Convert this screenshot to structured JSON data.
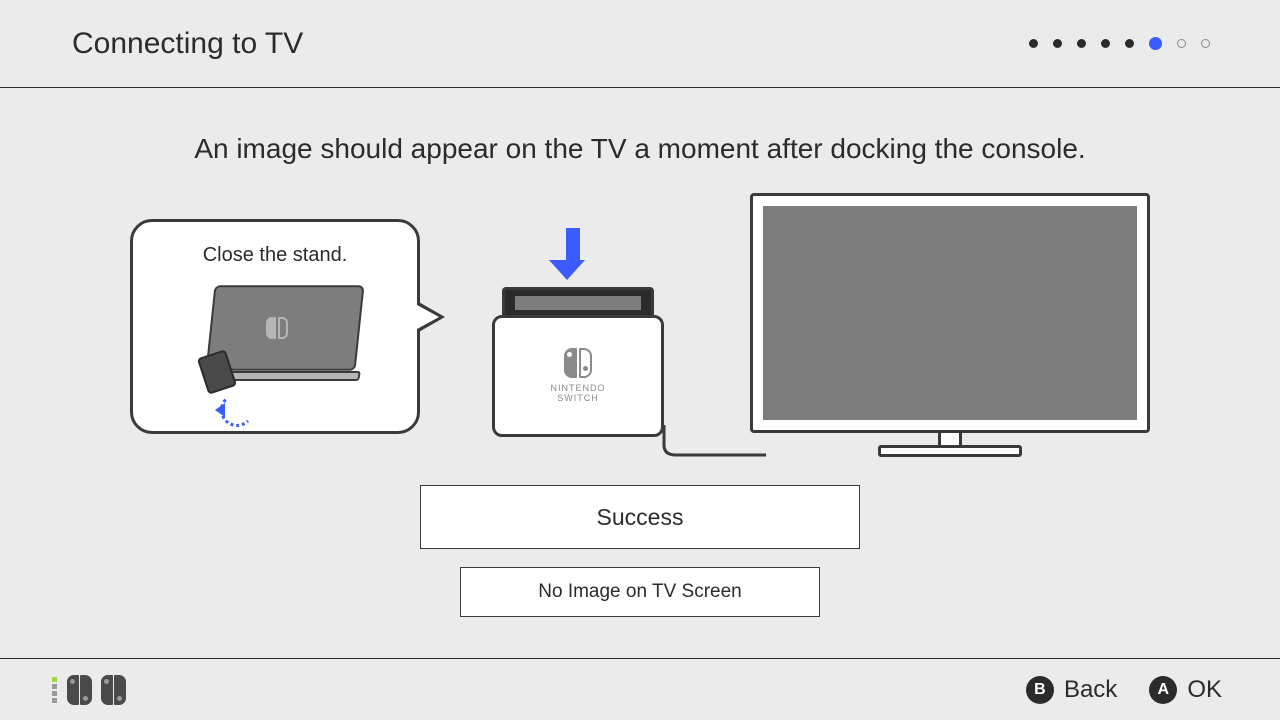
{
  "header": {
    "title": "Connecting to TV",
    "progress": {
      "total": 8,
      "current_index": 5
    }
  },
  "main": {
    "instruction": "An image should appear on the TV a moment after docking the console.",
    "speech_label": "Close the stand.",
    "dock_brand_top": "NINTENDO",
    "dock_brand_bottom": "SWITCH"
  },
  "buttons": {
    "primary": "Success",
    "secondary": "No Image on TV Screen"
  },
  "footer": {
    "b_label": "Back",
    "a_label": "OK",
    "b_glyph": "B",
    "a_glyph": "A"
  },
  "colors": {
    "accent": "#3b5bff",
    "bg": "#ebebeb",
    "ink": "#2b2b2b"
  }
}
